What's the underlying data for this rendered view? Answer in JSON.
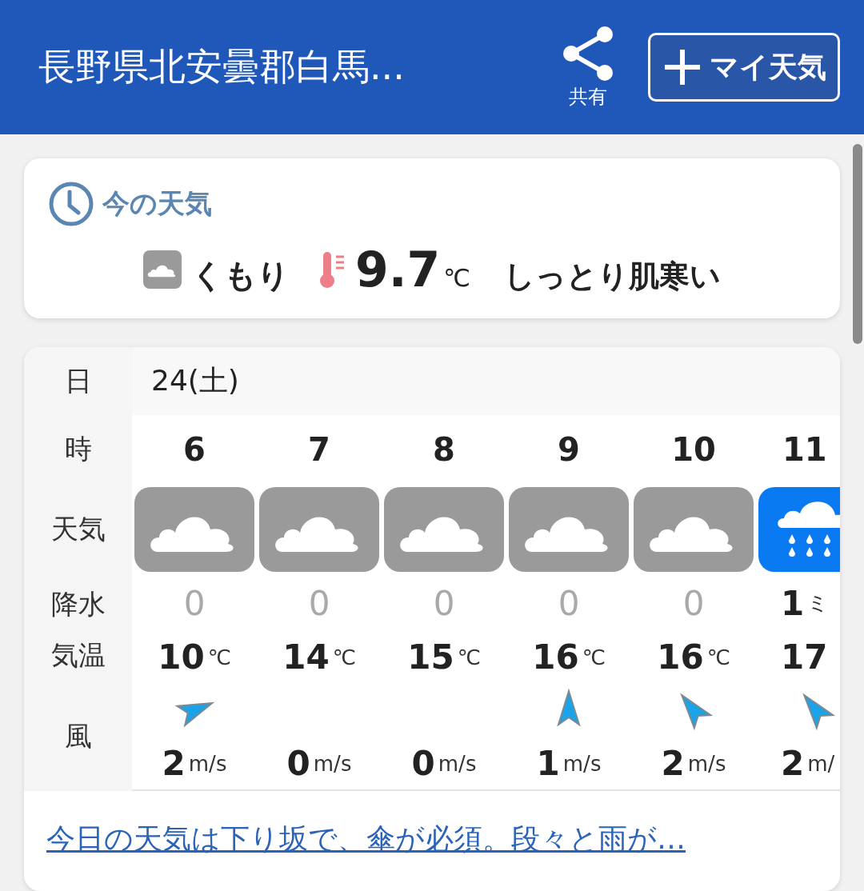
{
  "header": {
    "title": "長野県北安曇郡白馬...",
    "share_label": "共有",
    "my_weather_button": "マイ天気"
  },
  "current": {
    "title": "今の天気",
    "condition": {
      "text": "くもり",
      "kind": "cloudy"
    },
    "temperature": "9.7",
    "temperature_unit": "℃",
    "feeling": "しっとり肌寒い"
  },
  "forecast": {
    "row_labels": {
      "date": "日",
      "hour": "時",
      "weather": "天気",
      "precipitation": "降水",
      "temperature": "気温",
      "wind": "風"
    },
    "date": "24(土)",
    "hours": [
      {
        "hour": "6",
        "kind": "cloudy",
        "precipitation": "0",
        "greyed": true,
        "temperature": "10",
        "temperature_unit": "℃",
        "wind": {
          "kind": "ne",
          "speed": "2",
          "unit": "m/s"
        }
      },
      {
        "hour": "7",
        "kind": "cloudy",
        "precipitation": "0",
        "greyed": true,
        "temperature": "14",
        "temperature_unit": "℃",
        "wind": {
          "kind": "none",
          "speed": "0",
          "unit": "m/s"
        }
      },
      {
        "hour": "8",
        "kind": "cloudy",
        "precipitation": "0",
        "greyed": true,
        "temperature": "15",
        "temperature_unit": "℃",
        "wind": {
          "kind": "none",
          "speed": "0",
          "unit": "m/s"
        }
      },
      {
        "hour": "9",
        "kind": "cloudy",
        "precipitation": "0",
        "greyed": true,
        "temperature": "16",
        "temperature_unit": "℃",
        "wind": {
          "kind": "n",
          "speed": "1",
          "unit": "m/s"
        }
      },
      {
        "hour": "10",
        "kind": "cloudy",
        "precipitation": "0",
        "greyed": true,
        "temperature": "16",
        "temperature_unit": "℃",
        "wind": {
          "kind": "nw",
          "speed": "2",
          "unit": "m/s"
        }
      },
      {
        "hour": "11",
        "kind": "rain",
        "precipitation": "1",
        "precipitation_unit": "ミ",
        "greyed": false,
        "temperature": "17",
        "wind": {
          "kind": "nw",
          "speed": "2",
          "unit": "m/"
        }
      }
    ]
  },
  "summary_link": "今日の天気は下り坂で、傘が必須。段々と雨が…"
}
